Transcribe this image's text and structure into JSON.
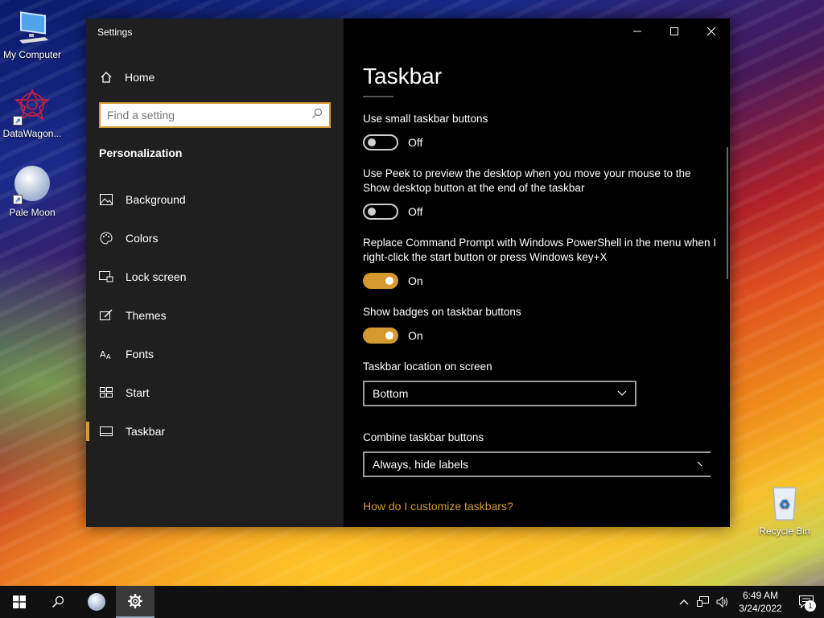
{
  "desktop": {
    "icons": [
      {
        "label": "My Computer"
      },
      {
        "label": "DataWagon..."
      },
      {
        "label": "Pale Moon"
      },
      {
        "label": "Recycle Bin"
      }
    ]
  },
  "window": {
    "app_title": "Settings",
    "home_label": "Home",
    "search_placeholder": "Find a setting",
    "section": "Personalization",
    "nav": [
      {
        "label": "Background",
        "icon": "image-icon"
      },
      {
        "label": "Colors",
        "icon": "palette-icon"
      },
      {
        "label": "Lock screen",
        "icon": "lock-screen-icon"
      },
      {
        "label": "Themes",
        "icon": "themes-icon"
      },
      {
        "label": "Fonts",
        "icon": "fonts-icon"
      },
      {
        "label": "Start",
        "icon": "start-icon"
      },
      {
        "label": "Taskbar",
        "icon": "taskbar-icon"
      }
    ],
    "active_nav": "Taskbar"
  },
  "content": {
    "title": "Taskbar",
    "settings": [
      {
        "label": "Use small taskbar buttons",
        "state": "Off"
      },
      {
        "label": "Use Peek to preview the desktop when you move your mouse to the Show desktop button at the end of the taskbar",
        "state": "Off"
      },
      {
        "label": "Replace Command Prompt with Windows PowerShell in the menu when I right-click the start button or press Windows key+X",
        "state": "On"
      },
      {
        "label": "Show badges on taskbar buttons",
        "state": "On"
      }
    ],
    "location": {
      "label": "Taskbar location on screen",
      "value": "Bottom"
    },
    "combine": {
      "label": "Combine taskbar buttons",
      "value": "Always, hide labels"
    },
    "help_link": "How do I customize taskbars?"
  },
  "taskbar": {
    "time": "6:49 AM",
    "date": "3/24/2022",
    "notification_count": "1"
  },
  "colors": {
    "accent": "#d59a2f",
    "sidebar_bg": "#1f1f1f",
    "content_bg": "#000000"
  }
}
